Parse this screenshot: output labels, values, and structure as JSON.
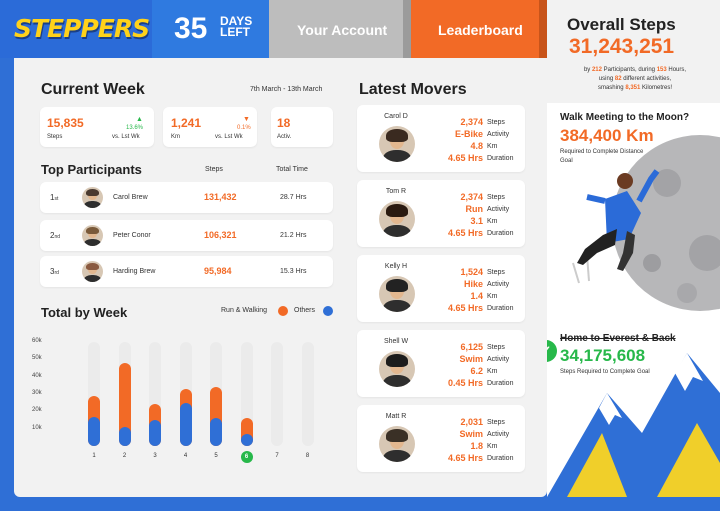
{
  "header": {
    "logo": "STEPPERS",
    "days_number": "35",
    "days_label": "DAYS LEFT",
    "account_label": "Your Account",
    "leaderboard_label": "Leaderboard"
  },
  "current_week": {
    "title": "Current Week",
    "date_range": "7th March - 13th March",
    "stats": [
      {
        "value": "15,835",
        "label": "Steps",
        "change": "13.6%",
        "direction": "up",
        "compare": "vs. Lst Wk"
      },
      {
        "value": "1,241",
        "label": "Km",
        "change": "0.1%",
        "direction": "down",
        "compare": "vs. Lst Wk"
      },
      {
        "value": "18",
        "label": "Activ."
      }
    ]
  },
  "top_participants": {
    "title": "Top Participants",
    "col_steps": "Steps",
    "col_time": "Total Time",
    "rows": [
      {
        "rank": "1",
        "suffix": "st",
        "name": "Carol Brew",
        "steps": "131,432",
        "time": "28.7 Hrs"
      },
      {
        "rank": "2",
        "suffix": "nd",
        "name": "Peter Conor",
        "steps": "106,321",
        "time": "21.2 Hrs"
      },
      {
        "rank": "3",
        "suffix": "rd",
        "name": "Harding Brew",
        "steps": "95,984",
        "time": "15.3 Hrs"
      }
    ]
  },
  "total_by_week": {
    "title": "Total by Week",
    "legend_run": "Run & Walking",
    "legend_others": "Others",
    "colors": {
      "run": "#f26a26",
      "others": "#2f6fd6",
      "current": "#27b84a"
    }
  },
  "chart_data": {
    "type": "bar",
    "stacked": true,
    "categories": [
      "1",
      "2",
      "3",
      "4",
      "5",
      "6",
      "7",
      "8"
    ],
    "highlight_category": "6",
    "yticks": [
      "60k",
      "50k",
      "40k",
      "30k",
      "20k",
      "10k"
    ],
    "ylim": [
      0,
      60000
    ],
    "series": [
      {
        "name": "Others",
        "values": [
          17000,
          11000,
          15000,
          25000,
          16000,
          7000,
          0,
          0
        ]
      },
      {
        "name": "Run & Walking",
        "values": [
          12000,
          37000,
          9000,
          8000,
          18000,
          9000,
          0,
          0
        ]
      }
    ],
    "grid": false,
    "legend_position": "top-right"
  },
  "latest_movers": {
    "title": "Latest Movers",
    "keys": {
      "steps": "Steps",
      "activity": "Activity",
      "km": "Km",
      "duration": "Duration"
    },
    "rows": [
      {
        "name": "Carol D",
        "steps": "2,374",
        "activity": "E-Bike",
        "km": "4.8",
        "duration": "4.65 Hrs"
      },
      {
        "name": "Tom R",
        "steps": "2,374",
        "activity": "Run",
        "km": "3.1",
        "duration": "4.65 Hrs"
      },
      {
        "name": "Kelly H",
        "steps": "1,524",
        "activity": "Hike",
        "km": "1.4",
        "duration": "4.65 Hrs"
      },
      {
        "name": "Shell W",
        "steps": "6,125",
        "activity": "Swim",
        "km": "6.2",
        "duration": "0.45 Hrs"
      },
      {
        "name": "Matt R",
        "steps": "2,031",
        "activity": "Swim",
        "km": "1.8",
        "duration": "4.65 Hrs"
      }
    ]
  },
  "overall": {
    "title": "Overall Steps",
    "value": "31,243,251",
    "sub_1": "by",
    "participants": "212",
    "sub_2": "Participants, during",
    "hours": "153",
    "sub_3": "Hours,",
    "sub_4": "using",
    "activities": "82",
    "sub_5": "different activities,",
    "sub_6": "smashing",
    "km": "8,351",
    "sub_7": "Kilometres!"
  },
  "moon_goal": {
    "title": "Walk Meeting to the Moon?",
    "value": "384,400 Km",
    "desc": "Required to Complete Distance Goal"
  },
  "everest_goal": {
    "title": "Home to Everest & Back",
    "value": "34,175,608",
    "desc": "Steps Required to Complete Goal"
  }
}
